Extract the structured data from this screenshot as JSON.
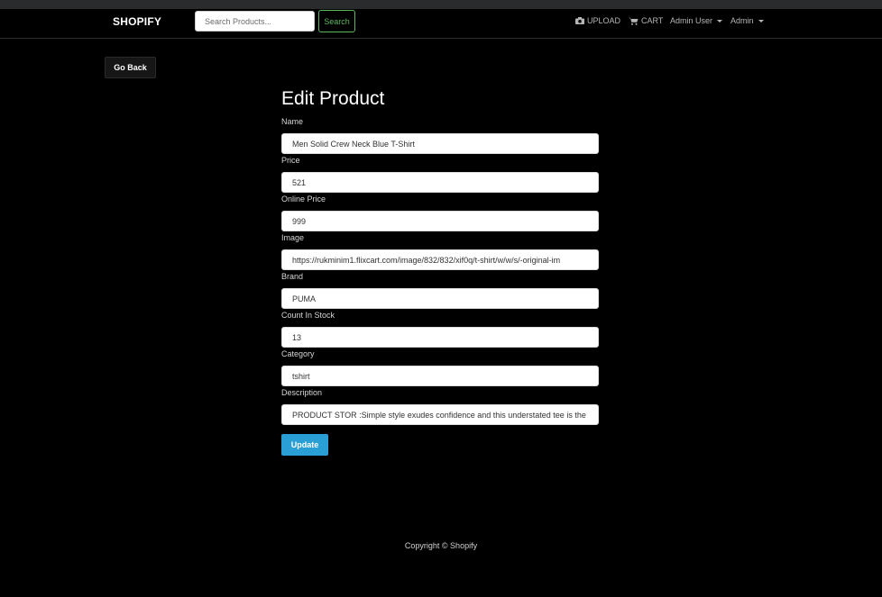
{
  "navbar": {
    "brand": "SHOPIFY",
    "search_placeholder": "Search Products...",
    "search_button": "Search",
    "upload_label": "UPLOAD",
    "upload_icon": "camera-icon",
    "cart_label": "CART",
    "cart_icon": "cart-icon",
    "user_menu": "Admin User",
    "admin_menu": "Admin"
  },
  "page": {
    "go_back": "Go Back",
    "title": "Edit Product"
  },
  "form": {
    "fields": [
      {
        "label": "Name",
        "value": "Men Solid Crew Neck Blue T-Shirt"
      },
      {
        "label": "Price",
        "value": "521"
      },
      {
        "label": "Online Price",
        "value": "999"
      },
      {
        "label": "Image",
        "value": "https://rukminim1.flixcart.com/image/832/832/xif0q/t-shirt/w/w/s/-original-im"
      },
      {
        "label": "Brand",
        "value": "PUMA"
      },
      {
        "label": "Count In Stock",
        "value": "13"
      },
      {
        "label": "Category",
        "value": "tshirt"
      },
      {
        "label": "Description",
        "value": "PRODUCT STOR :Simple style exudes confidence and this understated tee is the"
      }
    ],
    "submit": "Update"
  },
  "footer": {
    "copyright": "Copyright © Shopify"
  },
  "colors": {
    "background": "#000000",
    "accent": "#2a9fd6",
    "search_button": "#5cb85c"
  }
}
